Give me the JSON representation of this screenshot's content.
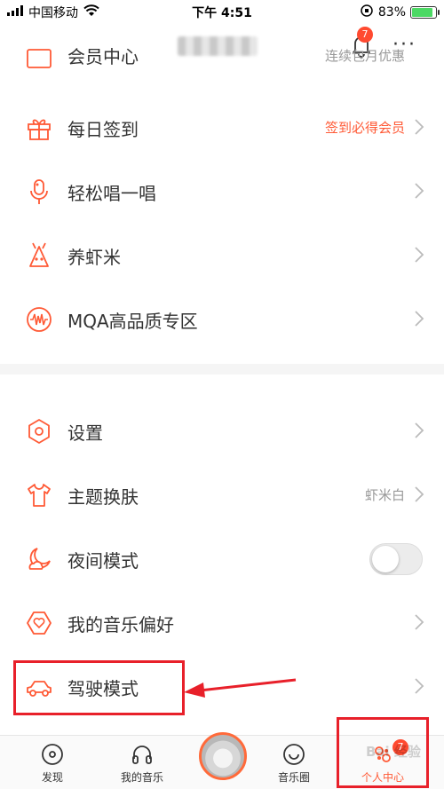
{
  "status_bar": {
    "carrier": "中国移动",
    "time": "下午 4:51",
    "battery": "83%",
    "battery_level": 0.83
  },
  "header": {
    "notification_count": "7"
  },
  "menu_top": {
    "partial_label": "会员中心",
    "partial_value": "连续包月优惠"
  },
  "menu_section1": [
    {
      "label": "每日签到",
      "value": "签到必得会员"
    },
    {
      "label": "轻松唱一唱",
      "value": ""
    },
    {
      "label": "养虾米",
      "value": ""
    },
    {
      "label": "MQA高品质专区",
      "value": ""
    }
  ],
  "menu_section2": [
    {
      "label": "设置",
      "value": ""
    },
    {
      "label": "主题换肤",
      "value": "虾米白"
    },
    {
      "label": "夜间模式",
      "value": "",
      "toggle": false
    },
    {
      "label": "我的音乐偏好",
      "value": ""
    },
    {
      "label": "驾驶模式",
      "value": ""
    }
  ],
  "colors": {
    "accent": "#ff5a36",
    "annotation": "#e8202a"
  },
  "tabbar": {
    "tabs": [
      {
        "label": "发现",
        "icon": "disc-icon"
      },
      {
        "label": "我的音乐",
        "icon": "headphones-icon"
      },
      {
        "label": "",
        "icon": "now-playing-album"
      },
      {
        "label": "音乐圈",
        "icon": "smile-icon"
      },
      {
        "label": "个人中心",
        "icon": "person-icon",
        "badge": "7"
      }
    ]
  },
  "watermark": "Bai 经验"
}
